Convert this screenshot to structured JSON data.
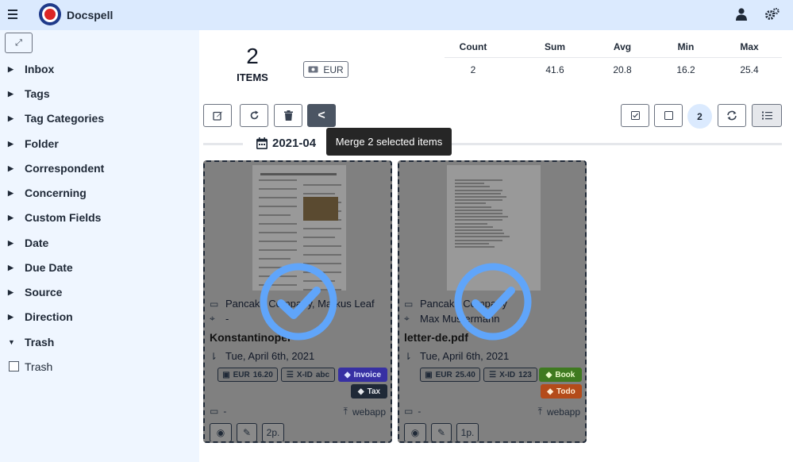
{
  "app": {
    "title": "Docspell"
  },
  "sidebar": {
    "expand_icon": "expand-icon",
    "items": [
      {
        "label": "Inbox",
        "expanded": false
      },
      {
        "label": "Tags",
        "expanded": false
      },
      {
        "label": "Tag Categories",
        "expanded": false
      },
      {
        "label": "Folder",
        "expanded": false
      },
      {
        "label": "Correspondent",
        "expanded": false
      },
      {
        "label": "Concerning",
        "expanded": false
      },
      {
        "label": "Custom Fields",
        "expanded": false
      },
      {
        "label": "Date",
        "expanded": false
      },
      {
        "label": "Due Date",
        "expanded": false
      },
      {
        "label": "Source",
        "expanded": false
      },
      {
        "label": "Direction",
        "expanded": false
      },
      {
        "label": "Trash",
        "expanded": true
      }
    ],
    "trash_checkbox": {
      "label": "Trash",
      "checked": false
    }
  },
  "summary": {
    "count": "2",
    "items_label": "ITEMS",
    "currency": "EUR",
    "stats_headers": [
      "Count",
      "Sum",
      "Avg",
      "Min",
      "Max"
    ],
    "stats_values": [
      "2",
      "41.6",
      "20.8",
      "16.2",
      "25.4"
    ]
  },
  "toolbar": {
    "merge_label": "<",
    "selected_count": "2",
    "tooltip": "Merge 2 selected items"
  },
  "group": {
    "date": "2021-04"
  },
  "cards": [
    {
      "correspondent": "Pancake Company, Markus Leaf",
      "concerning": "-",
      "title": "Konstantinopel",
      "date": "Tue, April 6th, 2021",
      "amount_currency": "EUR",
      "amount": "16.20",
      "xid_label": "X-ID",
      "xid": "abc",
      "tags": [
        "Invoice",
        "Tax"
      ],
      "folder": "-",
      "source": "webapp",
      "pages": "2p.",
      "selected": true
    },
    {
      "correspondent": "Pancake Company",
      "concerning": "Max Mustermann",
      "title": "letter-de.pdf",
      "date": "Tue, April 6th, 2021",
      "amount_currency": "EUR",
      "amount": "25.40",
      "xid_label": "X-ID",
      "xid": "123",
      "tags": [
        "Book",
        "Todo"
      ],
      "folder": "-",
      "source": "webapp",
      "pages": "1p.",
      "selected": true
    }
  ],
  "colors": {
    "topbar": "#dbeafe",
    "sidebar": "#eff6ff",
    "check": "#60a5fa",
    "tag_invoice": "#3730a3",
    "tag_tax": "#1f2937",
    "tag_book": "#3f7a20",
    "tag_todo": "#b44b1a"
  }
}
